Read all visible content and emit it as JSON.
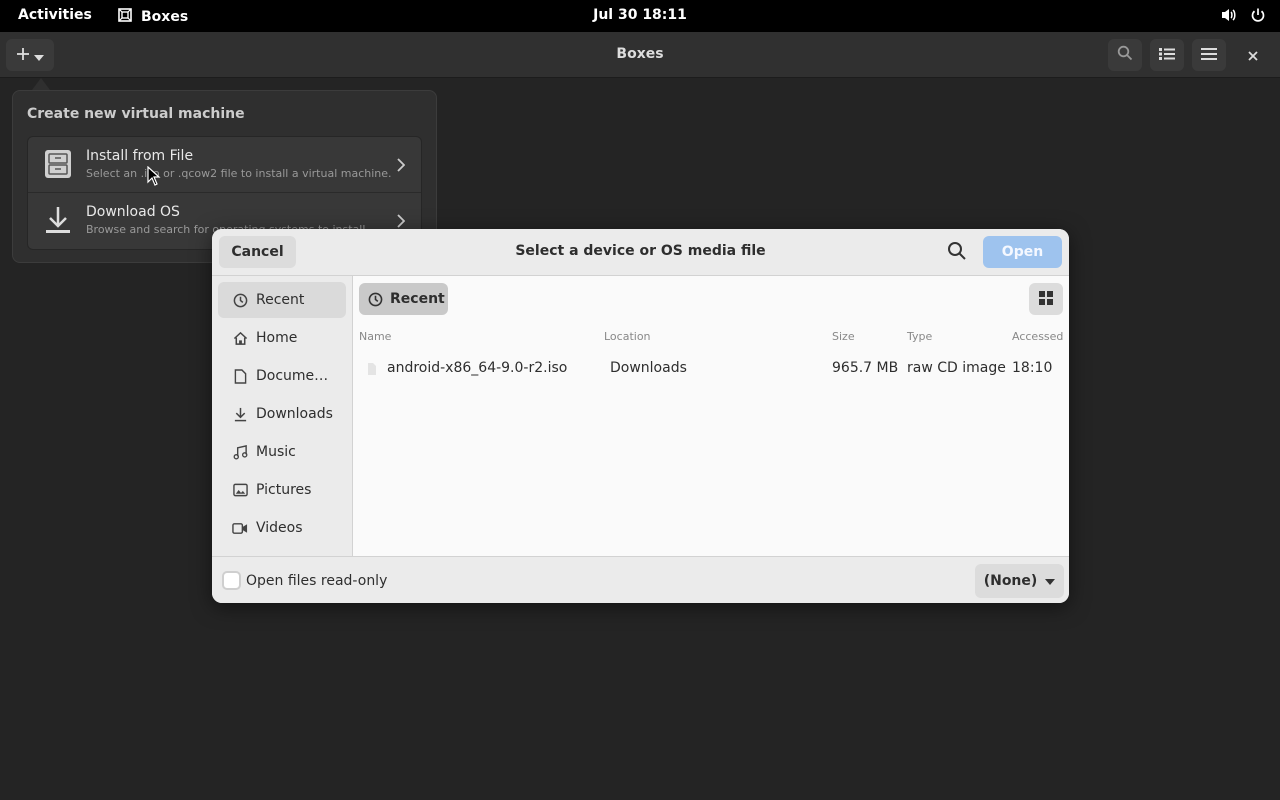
{
  "topbar": {
    "activities": "Activities",
    "app_name": "Boxes",
    "clock": "Jul 30  18:11"
  },
  "headerbar": {
    "title": "Boxes"
  },
  "popover": {
    "heading": "Create new virtual machine",
    "items": [
      {
        "title": "Install from File",
        "subtitle": "Select an .iso or .qcow2 file to install a virtual machine.",
        "icon": "file-cabinet-icon"
      },
      {
        "title": "Download OS",
        "subtitle": "Browse and search for operating systems to install.",
        "icon": "download-icon"
      }
    ]
  },
  "dialog": {
    "cancel": "Cancel",
    "title": "Select a device or OS media file",
    "open": "Open",
    "location": "Recent",
    "sidebar": [
      {
        "label": "Recent",
        "icon": "recent-icon"
      },
      {
        "label": "Home",
        "icon": "home-icon"
      },
      {
        "label": "Docume…",
        "icon": "document-icon"
      },
      {
        "label": "Downloads",
        "icon": "download-icon"
      },
      {
        "label": "Music",
        "icon": "music-icon"
      },
      {
        "label": "Pictures",
        "icon": "pictures-icon"
      },
      {
        "label": "Videos",
        "icon": "videos-icon"
      }
    ],
    "columns": {
      "name": "Name",
      "location": "Location",
      "size": "Size",
      "type": "Type",
      "accessed": "Accessed"
    },
    "files": [
      {
        "name": "android-x86_64-9.0-r2.iso",
        "location": "Downloads",
        "size": "965.7 MB",
        "type": "raw CD image",
        "accessed": "18:10"
      }
    ],
    "read_only_label": "Open files read-only",
    "filter": "(None)"
  },
  "colors": {
    "accent_disabled": "#9ec3ee",
    "dark_bg": "#242424"
  }
}
